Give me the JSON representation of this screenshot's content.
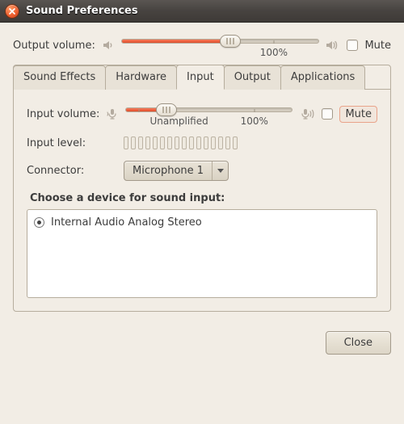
{
  "window": {
    "title": "Sound Preferences"
  },
  "output": {
    "label": "Output volume:",
    "value_pct": 55,
    "tick_label": "100%",
    "mute_label": "Mute",
    "muted": false
  },
  "tabs": [
    {
      "label": "Sound Effects",
      "active": false
    },
    {
      "label": "Hardware",
      "active": false
    },
    {
      "label": "Input",
      "active": true
    },
    {
      "label": "Output",
      "active": false
    },
    {
      "label": "Applications",
      "active": false
    }
  ],
  "input": {
    "volume_label": "Input volume:",
    "value_pct": 24,
    "tick_labels": {
      "left": "Unamplified",
      "right": "100%"
    },
    "mute_label": "Mute",
    "muted": false,
    "level_label": "Input level:",
    "level_segments": 16,
    "connector_label": "Connector:",
    "connector_value": "Microphone 1",
    "device_heading": "Choose a device for sound input:",
    "devices": [
      {
        "label": "Internal Audio Analog Stereo",
        "selected": true
      }
    ]
  },
  "footer": {
    "close_label": "Close"
  }
}
